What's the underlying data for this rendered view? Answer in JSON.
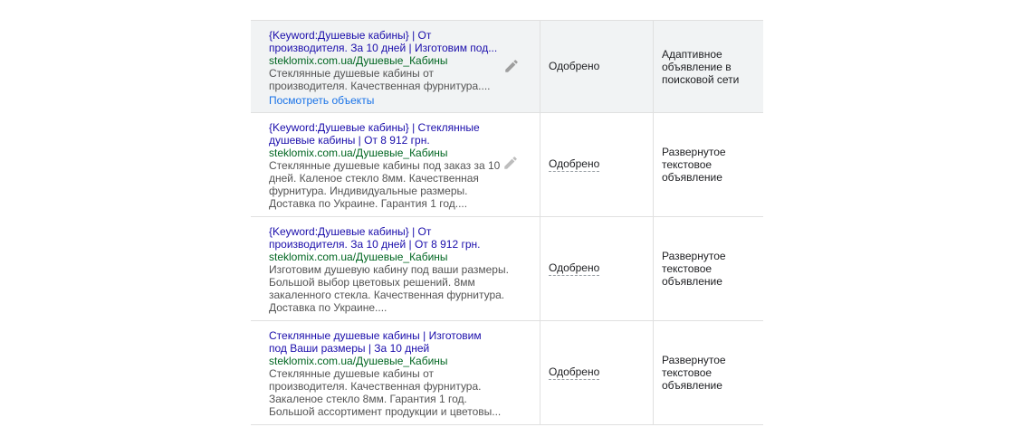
{
  "rows": [
    {
      "headline": "{Keyword:Душевые кабины} | От производителя. За 10 дней | Изготовим под...",
      "url": "steklomix.com.ua/Душевые_Кабины",
      "description": "Стеклянные душевые кабины от производителя. Качественная фурнитура....",
      "view_assets_link": "Посмотреть объекты",
      "status": "Одобрено",
      "ad_type": "Адаптивное объявление в поисковой сети",
      "edit_icon": "pencil-icon"
    },
    {
      "headline": "{Keyword:Душевые кабины} | Стеклянные душевые кабины | От 8 912 грн.",
      "url": "steklomix.com.ua/Душевые_Кабины",
      "description": "Стеклянные душевые кабины под заказ за 10 дней. Каленое стекло 8мм. Качественная фурнитура. Индивидуальные размеры. Доставка по Украине. Гарантия 1 год....",
      "status": "Одобрено",
      "ad_type": "Развернутое текстовое объявление",
      "edit_icon": "pencil-icon"
    },
    {
      "headline": "{Keyword:Душевые кабины} | От производителя. За 10 дней | От 8 912 грн.",
      "url": "steklomix.com.ua/Душевые_Кабины",
      "description": "Изготовим душевую кабину под ваши размеры. Большой выбор цветовых решений. 8мм закаленного стекла. Качественная фурнитура. Доставка по Украине....",
      "status": "Одобрено",
      "ad_type": "Развернутое текстовое объявление"
    },
    {
      "headline": "Стеклянные душевые кабины | Изготовим под Ваши размеры | За 10 дней",
      "url": "steklomix.com.ua/Душевые_Кабины",
      "description": "Стеклянные душевые кабины от производителя. Качественная фурнитура. Закаленое стекло 8мм. Гарантия 1 год. Большой ассортимент продукции и цветовы...",
      "status": "Одобрено",
      "ad_type": "Развернутое текстовое объявление"
    }
  ]
}
